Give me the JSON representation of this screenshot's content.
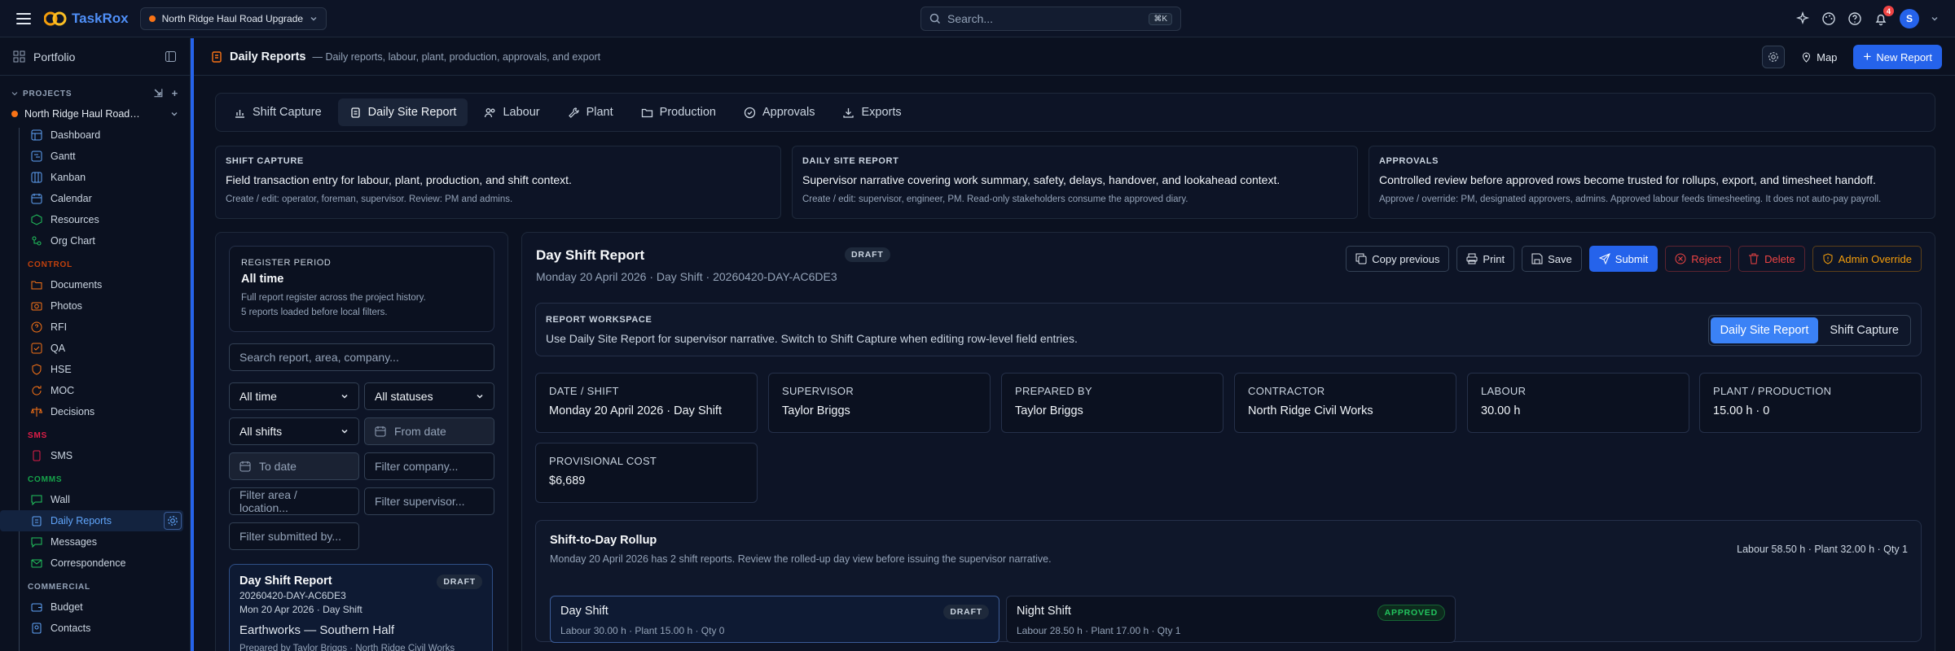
{
  "app": {
    "name": "TaskRox",
    "project_switcher": "North Ridge Haul Road Upgrade",
    "notifications_count": "4",
    "user_initial": "S"
  },
  "search": {
    "placeholder": "Search...",
    "shortcut": "⌘K"
  },
  "sidebar": {
    "portfolio": "Portfolio",
    "projects_heading": "PROJECTS",
    "project_name": "North Ridge Haul Road…",
    "items": [
      {
        "label": "Dashboard"
      },
      {
        "label": "Gantt"
      },
      {
        "label": "Kanban"
      },
      {
        "label": "Calendar"
      },
      {
        "label": "Resources"
      },
      {
        "label": "Org Chart"
      }
    ],
    "control_heading": "CONTROL",
    "control_items": [
      {
        "label": "Documents"
      },
      {
        "label": "Photos"
      },
      {
        "label": "RFI"
      },
      {
        "label": "QA"
      },
      {
        "label": "HSE"
      },
      {
        "label": "MOC"
      },
      {
        "label": "Decisions"
      }
    ],
    "sms_heading": "SMS",
    "sms_items": [
      {
        "label": "SMS"
      }
    ],
    "comms_heading": "COMMS",
    "comms_items": [
      {
        "label": "Wall"
      },
      {
        "label": "Daily Reports"
      },
      {
        "label": "Messages"
      },
      {
        "label": "Correspondence"
      }
    ],
    "commercial_heading": "COMMERCIAL",
    "commercial_items": [
      {
        "label": "Budget"
      },
      {
        "label": "Contacts"
      }
    ]
  },
  "page": {
    "title": "Daily Reports",
    "subtitle": "— Daily reports, labour, plant, production, approvals, and export",
    "map_label": "Map",
    "new_report_label": "New Report"
  },
  "tabs": [
    {
      "label": "Shift Capture"
    },
    {
      "label": "Daily Site Report"
    },
    {
      "label": "Labour"
    },
    {
      "label": "Plant"
    },
    {
      "label": "Production"
    },
    {
      "label": "Approvals"
    },
    {
      "label": "Exports"
    }
  ],
  "info_cards": [
    {
      "kicker": "SHIFT CAPTURE",
      "title": "Field transaction entry for labour, plant, production, and shift context.",
      "sub": "Create / edit: operator, foreman, supervisor. Review: PM and admins."
    },
    {
      "kicker": "DAILY SITE REPORT",
      "title": "Supervisor narrative covering work summary, safety, delays, handover, and lookahead context.",
      "sub": "Create / edit: supervisor, engineer, PM. Read-only stakeholders consume the approved diary."
    },
    {
      "kicker": "APPROVALS",
      "title": "Controlled review before approved rows become trusted for rollups, export, and timesheet handoff.",
      "sub": "Approve / override: PM, designated approvers, admins. Approved labour feeds timesheeting. It does not auto-pay payroll."
    }
  ],
  "register": {
    "kicker": "REGISTER PERIOD",
    "value": "All time",
    "line1": "Full report register across the project history.",
    "line2": "5 reports loaded before local filters."
  },
  "filters": {
    "search_placeholder": "Search report, area, company...",
    "time": "All time",
    "status": "All statuses",
    "shift": "All shifts",
    "from_date": "From date",
    "to_date": "To date",
    "company": "Filter company...",
    "area": "Filter area / location...",
    "supervisor": "Filter supervisor...",
    "submitted": "Filter submitted by..."
  },
  "report_card": {
    "title": "Day Shift Report",
    "status": "DRAFT",
    "id": "20260420-DAY-AC6DE3",
    "date": "Mon 20 Apr 2026 · Day Shift",
    "area": "Earthworks — Southern Half",
    "prepared": "Prepared by Taylor Briggs · North Ridge Civil Works"
  },
  "detail": {
    "title": "Day Shift Report",
    "status": "DRAFT",
    "subtitle": "Monday 20 April 2026 · Day Shift · 20260420-DAY-AC6DE3",
    "actions": {
      "copy": "Copy previous",
      "print": "Print",
      "save": "Save",
      "submit": "Submit",
      "reject": "Reject",
      "delete": "Delete",
      "override": "Admin Override"
    },
    "workspace": {
      "kicker": "REPORT WORKSPACE",
      "text": "Use Daily Site Report for supervisor narrative. Switch to Shift Capture when editing row-level field entries.",
      "seg_on": "Daily Site Report",
      "seg_off": "Shift Capture"
    },
    "stats": [
      {
        "label": "DATE / SHIFT",
        "value": "Monday 20 April 2026 · Day Shift"
      },
      {
        "label": "SUPERVISOR",
        "value": "Taylor Briggs"
      },
      {
        "label": "PREPARED BY",
        "value": "Taylor Briggs"
      },
      {
        "label": "CONTRACTOR",
        "value": "North Ridge Civil Works"
      },
      {
        "label": "LABOUR",
        "value": "30.00 h"
      },
      {
        "label": "PLANT / PRODUCTION",
        "value": "15.00 h · 0"
      },
      {
        "label": "PROVISIONAL COST",
        "value": "$6,689"
      }
    ],
    "rollup": {
      "title": "Shift-to-Day Rollup",
      "sub": "Monday 20 April 2026 has 2 shift reports. Review the rolled-up day view before issuing the supervisor narrative.",
      "totals": "Labour 58.50 h · Plant 32.00 h · Qty 1",
      "shifts": [
        {
          "name": "Day Shift",
          "status": "DRAFT",
          "detail": "Labour 30.00 h · Plant 15.00 h · Qty 0"
        },
        {
          "name": "Night Shift",
          "status": "APPROVED",
          "detail": "Labour 28.50 h · Plant 17.00 h · Qty 1"
        }
      ]
    }
  }
}
